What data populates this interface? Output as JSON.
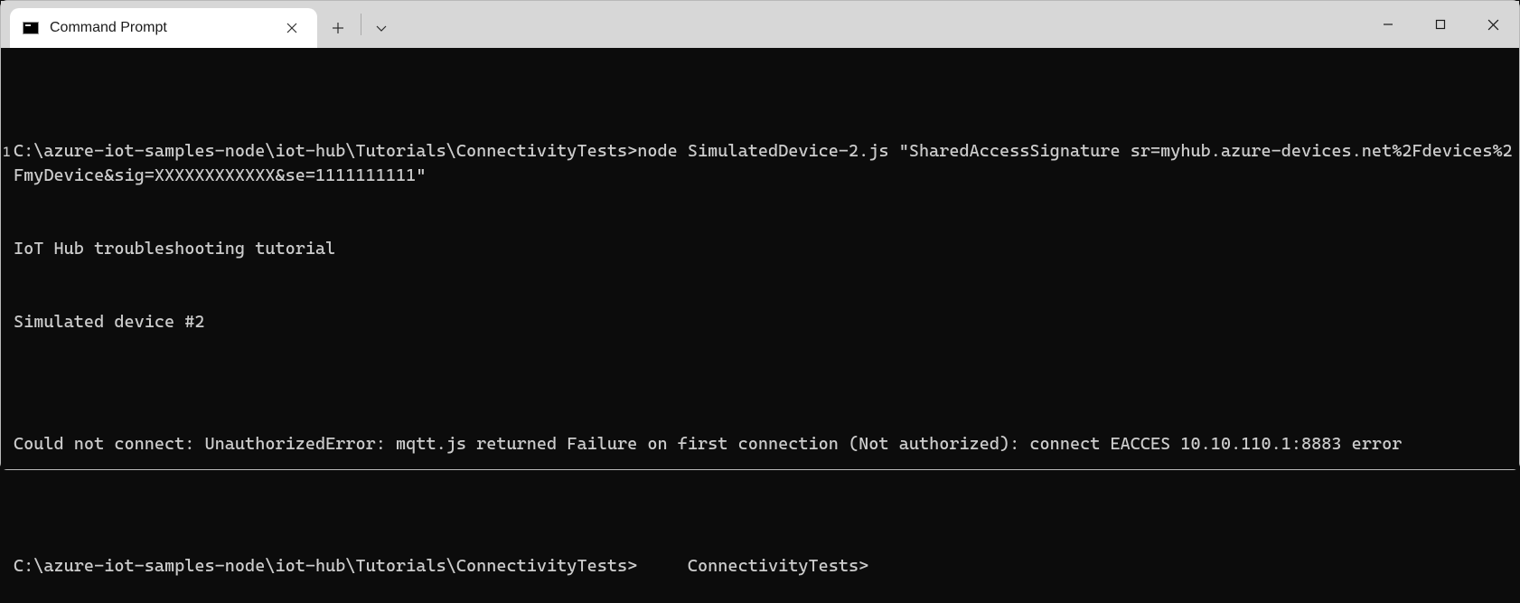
{
  "window": {
    "tab_title": "Command Prompt"
  },
  "terminal": {
    "gutter_mark": "1",
    "lines": [
      "C:\\azure-iot-samples-node\\iot-hub\\Tutorials\\ConnectivityTests>node SimulatedDevice-2.js \"SharedAccessSignature sr=myhub.azure-devices.net%2Fdevices%2FmyDevice&sig=XXXXXXXXXXXX&se=1111111111\"",
      "IoT Hub troubleshooting tutorial",
      "Simulated device #2",
      "",
      "Could not connect: UnauthorizedError: mqtt.js returned Failure on first connection (Not authorized): connect EACCES 10.10.110.1:8883 error",
      "",
      "C:\\azure-iot-samples-node\\iot-hub\\Tutorials\\ConnectivityTests>     ConnectivityTests>"
    ]
  }
}
